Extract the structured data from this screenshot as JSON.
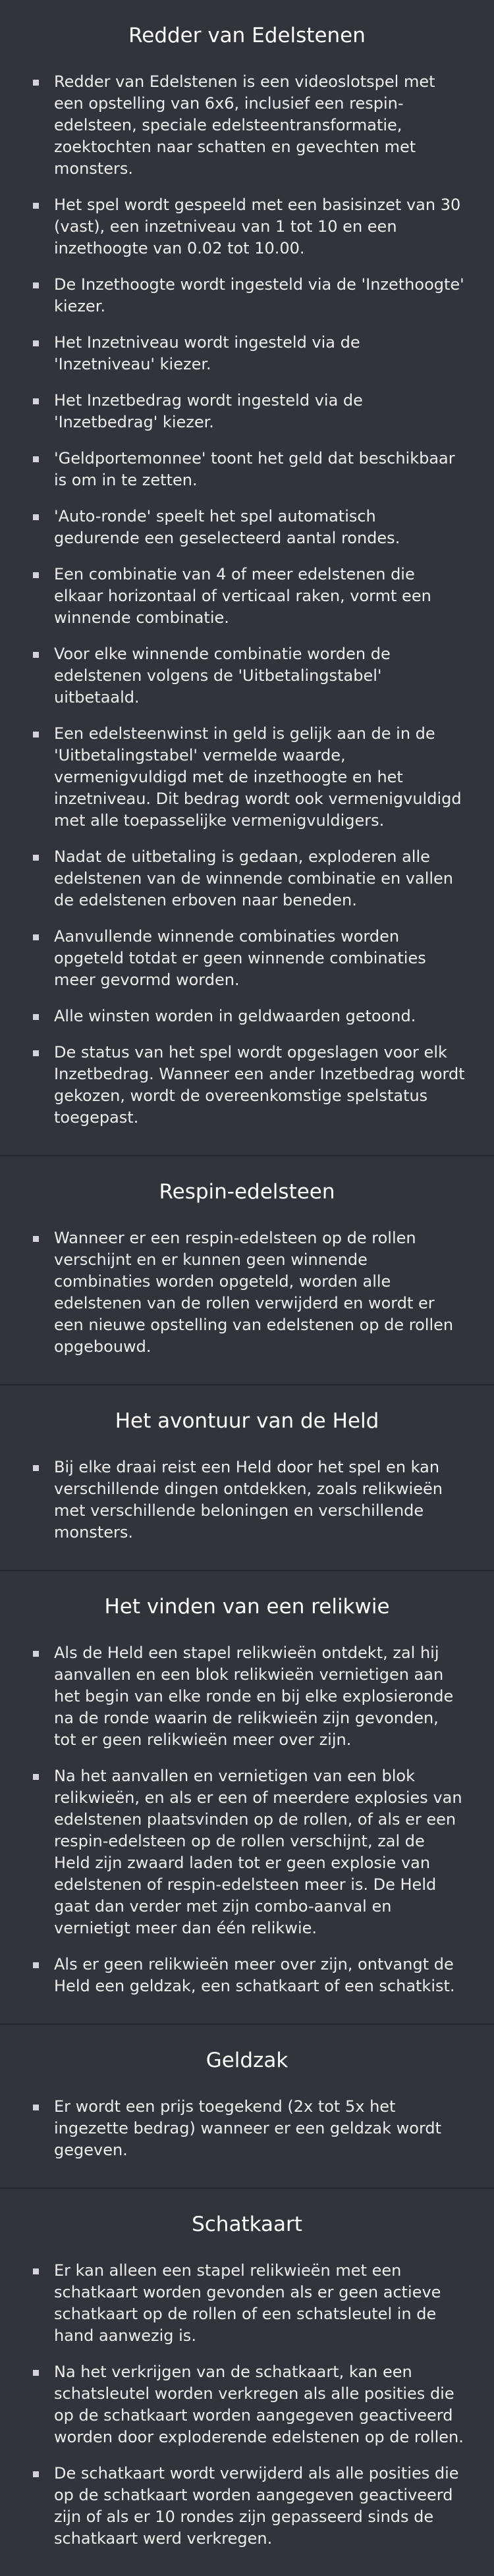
{
  "sections": [
    {
      "title": "Redder van Edelstenen",
      "items": [
        "Redder van Edelstenen is een videoslotspel met een opstelling van 6x6, inclusief een respin-edelsteen, speciale edelsteentransformatie, zoektochten naar schatten en gevechten met monsters.",
        "Het spel wordt gespeeld met een basisinzet van 30 (vast), een inzetniveau van 1 tot 10 en een inzethoogte van 0.02 tot 10.00.",
        "De Inzethoogte wordt ingesteld via de 'Inzethoogte' kiezer.",
        "Het Inzetniveau wordt ingesteld via de 'Inzetniveau' kiezer.",
        "Het Inzetbedrag wordt ingesteld via de 'Inzetbedrag' kiezer.",
        "'Geldportemonnee' toont het geld dat beschikbaar is om in te zetten.",
        "'Auto-ronde' speelt het spel automatisch gedurende een geselecteerd aantal rondes.",
        "Een combinatie van 4 of meer edelstenen die elkaar horizontaal of verticaal raken, vormt een winnende combinatie.",
        "Voor elke winnende combinatie worden de edelstenen volgens de 'Uitbetalingstabel' uitbetaald.",
        "Een edelsteenwinst in geld is gelijk aan de in de 'Uitbetalingstabel' vermelde waarde, vermenigvuldigd met de inzethoogte en het inzetniveau. Dit bedrag wordt ook vermenigvuldigd met alle toepasselijke vermenigvuldigers.",
        "Nadat de uitbetaling is gedaan, exploderen alle edelstenen van de winnende combinatie en vallen de edelstenen erboven naar beneden.",
        "Aanvullende winnende combinaties worden opgeteld totdat er geen winnende combinaties meer gevormd worden.",
        "Alle winsten worden in geldwaarden getoond.",
        "De status van het spel wordt opgeslagen voor elk Inzetbedrag. Wanneer een ander Inzetbedrag wordt gekozen, wordt de overeenkomstige spelstatus toegepast."
      ]
    },
    {
      "title": "Respin-edelsteen",
      "items": [
        "Wanneer er een respin-edelsteen op de rollen verschijnt en er kunnen geen winnende combinaties worden opgeteld, worden alle edelstenen van de rollen verwijderd en wordt er een nieuwe opstelling van edelstenen op de rollen opgebouwd."
      ]
    },
    {
      "title": "Het avontuur van de Held",
      "items": [
        "Bij elke draai reist een Held door het spel en kan verschillende dingen ontdekken, zoals relikwieën met verschillende beloningen en verschillende monsters."
      ]
    },
    {
      "title": "Het vinden van een relikwie",
      "items": [
        "Als de Held een stapel relikwieën ontdekt, zal hij aanvallen en een blok relikwieën vernietigen aan het begin van elke ronde en bij elke explosieronde na de ronde waarin de relikwieën zijn gevonden, tot er geen relikwieën meer over zijn.",
        "Na het aanvallen en vernietigen van een blok relikwieën, en als er een of meerdere explosies van edelstenen plaatsvinden op de rollen, of als er een respin-edelsteen op de rollen verschijnt, zal de Held zijn zwaard laden tot er geen explosie van edelstenen of respin-edelsteen meer is. De Held gaat dan verder met zijn combo-aanval en vernietigt meer dan één relikwie.",
        "Als er geen relikwieën meer over zijn, ontvangt de Held een geldzak, een schatkaart of een schatkist."
      ]
    },
    {
      "title": "Geldzak",
      "items": [
        "Er wordt een prijs toegekend (2x tot 5x het ingezette bedrag) wanneer er een geldzak wordt gegeven."
      ]
    },
    {
      "title": "Schatkaart",
      "items": [
        "Er kan alleen een stapel relikwieën met een schatkaart worden gevonden als er geen actieve schatkaart op de rollen of een schatsleutel in de hand aanwezig is.",
        "Na het verkrijgen van de schatkaart, kan een schatsleutel worden verkregen als alle posities die op de schatkaart worden aangegeven geactiveerd worden door exploderende edelstenen op de rollen.",
        "De schatkaart wordt verwijderd als alle posities die op de schatkaart worden aangegeven geactiveerd zijn of als er 10 rondes zijn gepasseerd sinds de schatkaart werd verkregen."
      ]
    }
  ]
}
